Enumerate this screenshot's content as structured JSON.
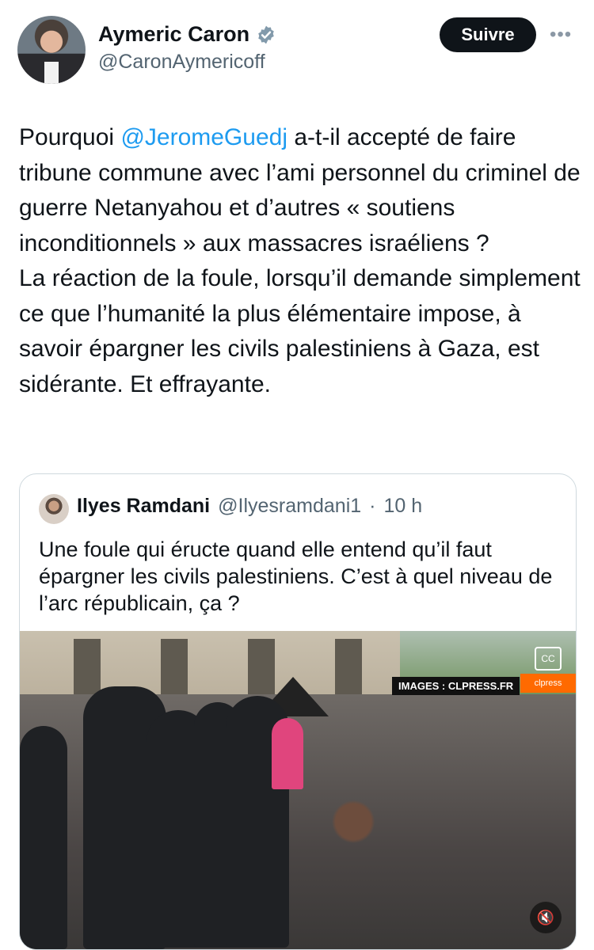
{
  "author": {
    "name": "Aymeric Caron",
    "handle": "@CaronAymericoff",
    "verified": true
  },
  "actions": {
    "follow_label": "Suivre",
    "more_icon": "more-horizontal-icon"
  },
  "tweet": {
    "pre_mention": "Pourquoi ",
    "mention": "@JeromeGuedj",
    "post_mention": " a-t-il accepté de faire tribune commune avec l’ami personnel du criminel de guerre Netanyahou et d’autres « soutiens inconditionnels » aux massacres israéliens ?",
    "paragraph2": "La réaction de la foule, lorsqu’il demande simplement ce que l’humanité la plus élémentaire impose, à savoir épargner les civils palestiniens à Gaza, est sidérante. Et effrayante."
  },
  "quoted": {
    "name": "Ilyes Ramdani",
    "handle": "@Ilyesramdani1",
    "dot": "·",
    "time": "10 h",
    "text": "Une foule qui éructe quand elle entend qu’il faut épargner les civils palestiniens. C’est à quel niveau de l’arc républicain, ça ?",
    "media": {
      "watermark": "IMAGES : CLPRESS.FR",
      "logo": "clpress",
      "captions_icon": "closed-captions-icon",
      "mute_icon": "volume-muted-icon"
    }
  },
  "colors": {
    "accent": "#1d9bf0",
    "text": "#0f1419",
    "muted": "#536471",
    "border": "#cfd9de"
  }
}
